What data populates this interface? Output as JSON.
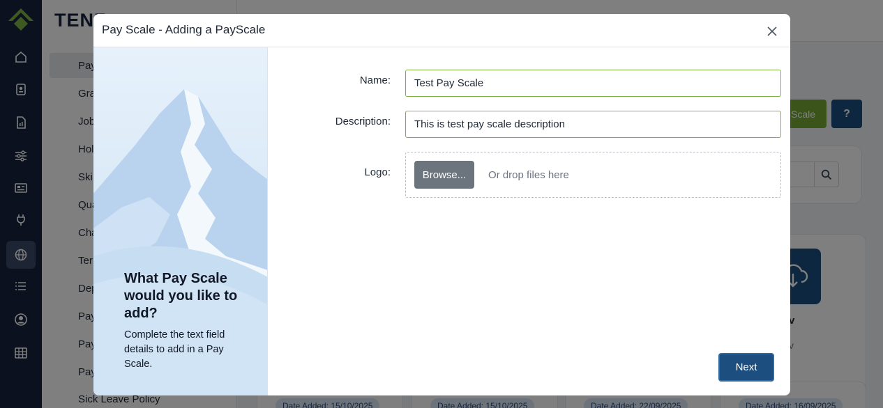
{
  "app": {
    "brand": "TENZ",
    "subnav_items": [
      {
        "label": "Pay"
      },
      {
        "label": "Gra"
      },
      {
        "label": "Job"
      },
      {
        "label": "Hol"
      },
      {
        "label": "Ski"
      },
      {
        "label": "Qua"
      },
      {
        "label": "Cha"
      },
      {
        "label": "Ter"
      },
      {
        "label": "Dep"
      },
      {
        "label": "Pay"
      },
      {
        "label": "Pay"
      },
      {
        "label": "Pay"
      },
      {
        "label": "Sick Leave Policy"
      }
    ],
    "rail_icons": [
      "home-icon",
      "id-badge-icon",
      "report-icon",
      "sliders-icon",
      "newspaper-icon",
      "plug-icon",
      "globe-icon",
      "list-icon",
      "user-circle-icon",
      "table-icon"
    ],
    "add_button_text": "Scale",
    "help_button_text": "?",
    "card_text_1": "v",
    "card_text_2": "v",
    "date_chips": [
      "Date Added: 15/10/2025",
      "Date Added: 15/10/2025",
      "Date Added: 22/09/2025",
      "Date Added: 16/09/2025"
    ]
  },
  "modal": {
    "title": "Pay Scale - Adding a PayScale",
    "side": {
      "title": "What Pay Scale would you like to add?",
      "description": "Complete the text field details to add in a Pay Scale."
    },
    "form": {
      "name_label": "Name:",
      "name_value": "Test Pay Scale",
      "description_label": "Description:",
      "description_value": "This is test pay scale description",
      "logo_label": "Logo:",
      "browse_label": "Browse...",
      "drop_hint": "Or drop files here"
    },
    "next_label": "Next"
  },
  "colors": {
    "primary": "#1c4e80",
    "accent_green": "#74a934",
    "nav_dark": "#16233f",
    "input_border": "#7cb342"
  }
}
